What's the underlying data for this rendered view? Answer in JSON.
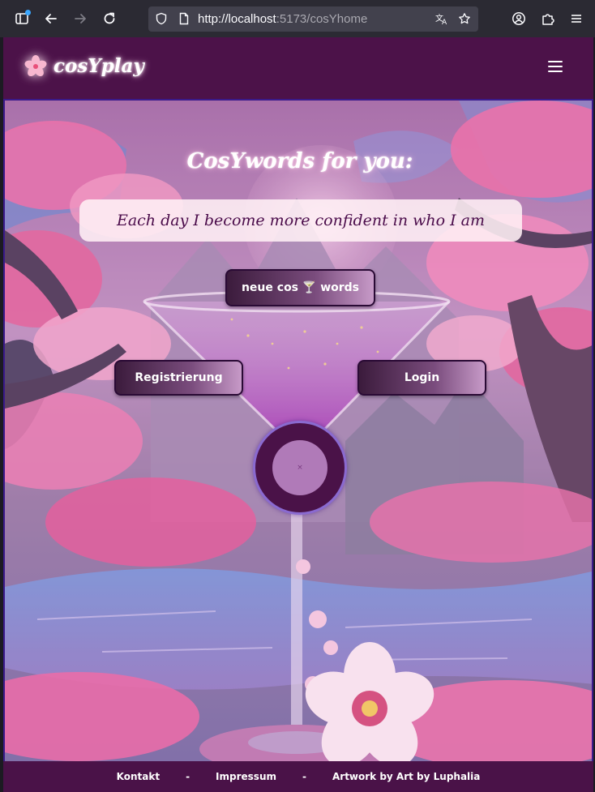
{
  "browser": {
    "url_host": "http://localhost",
    "url_path": ":5173/cosYhome"
  },
  "header": {
    "logo_text": "cosYplay",
    "menu_icon": "hamburger-icon"
  },
  "hero": {
    "title": "CosYwords for you:",
    "quote": "Each day I become more confident in who I am",
    "new_words_label": "neue cos 🍸 words",
    "register_label": "Registrierung",
    "login_label": "Login",
    "orb_mark": "×"
  },
  "footer": {
    "contact": "Kontakt",
    "sep1": "-",
    "imprint": "Impressum",
    "sep2": "-",
    "artwork": "Artwork by Art by Luphalia"
  },
  "colors": {
    "header_bg": "#4c1249",
    "footer_bg": "#4a1248",
    "button_gradient_start": "#3b1b3c",
    "button_gradient_end": "#c79ac8",
    "quote_text": "#4a0b4a"
  }
}
